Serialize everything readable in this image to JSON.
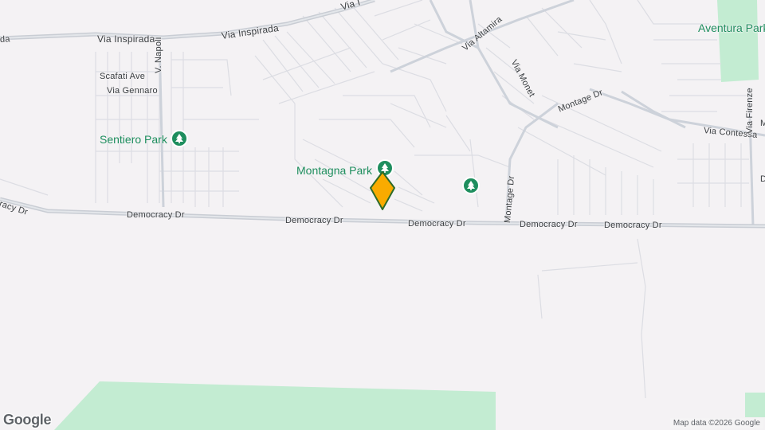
{
  "map": {
    "roads": {
      "via_inspirada_1": "Via Inspirada",
      "via_inspirada_2": "Via Inspirada",
      "via_inspirada_3": "Via I",
      "via_inspirada_edge": "da",
      "via_napoli": "V. Napoli",
      "scafati_ave": "Scafati Ave",
      "via_gennaro": "Via Gennaro",
      "via_altamira": "Via Altamira",
      "via_monet": "Via Monet",
      "montage_dr_1": "Montage Dr",
      "montage_dr_2": "Montage Dr",
      "via_contessa": "Via Contessa",
      "via_firenze": "Via Firenze",
      "democracy_dr_edge": "cracy Dr",
      "democracy_dr_1": "Democracy Dr",
      "democracy_dr_2": "Democracy Dr",
      "democracy_dr_3": "Democracy Dr",
      "democracy_dr_4": "Democracy Dr",
      "democracy_dr_5": "Democracy Dr",
      "edge_m": "M",
      "edge_d": "D"
    },
    "parks": {
      "sentiero": "Sentiero Park",
      "montagna": "Montagna Park",
      "aventura": "Aventura Park"
    },
    "marker_color": "#f9ab00",
    "park_color": "#1e8e5e",
    "green_area_color": "#c3ecd2"
  },
  "attribution": "Map data ©2026 Google",
  "logo": "Google"
}
